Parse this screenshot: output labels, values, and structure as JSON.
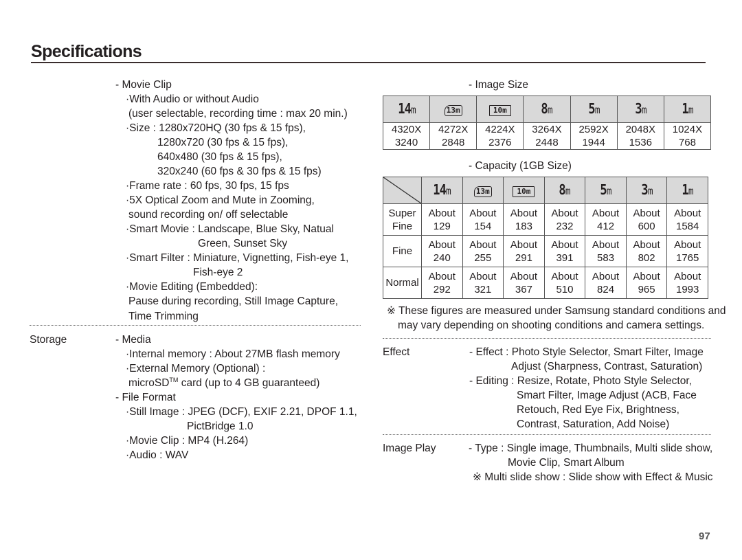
{
  "page": {
    "title": "Specifications",
    "page_number": "97"
  },
  "left_column": {
    "movie_clip": {
      "heading": "- Movie Clip",
      "lines": [
        "·With Audio or without Audio",
        "(user selectable, recording time : max 20 min.)",
        "·Size : 1280x720HQ (30 fps & 15 fps),",
        "1280x720 (30 fps & 15 fps),",
        "640x480 (30 fps & 15 fps),",
        "320x240 (60 fps & 30 fps & 15 fps)",
        "·Frame rate : 60 fps, 30 fps, 15 fps",
        "·5X Optical Zoom and Mute in Zooming,",
        "sound recording on/ off selectable",
        "·Smart Movie : Landscape, Blue Sky, Natual",
        "Green, Sunset Sky",
        "·Smart Filter : Miniature, Vignetting, Fish-eye 1,",
        "Fish-eye 2",
        "·Movie Editing (Embedded):",
        "Pause during recording, Still Image Capture,",
        "Time Trimming"
      ]
    },
    "storage": {
      "label": "Storage",
      "media_heading": "- Media",
      "internal": "·Internal memory : About 27MB flash memory",
      "external": "·External Memory (Optional) :",
      "microsd_prefix": "microSD",
      "microsd_tm": "TM",
      "microsd_suffix": " card (up to 4 GB guaranteed)",
      "file_format_heading": "- File Format",
      "still_image": "·Still Image : JPEG (DCF), EXIF 2.21, DPOF 1.1,",
      "still_image_cont": "PictBridge 1.0",
      "movie_clip": "·Movie Clip : MP4 (H.264)",
      "audio": "·Audio : WAV"
    }
  },
  "right_column": {
    "image_size": {
      "heading": "- Image Size",
      "icons": [
        {
          "name": "14m-icon",
          "main": "14",
          "unit": "m"
        },
        {
          "name": "13m-wide-icon",
          "main": "13",
          "unit": "m"
        },
        {
          "name": "10m-panorama-icon",
          "main": "10",
          "unit": "m"
        },
        {
          "name": "8m-icon",
          "main": "8",
          "unit": "m"
        },
        {
          "name": "5m-icon",
          "main": "5",
          "unit": "m"
        },
        {
          "name": "3m-icon",
          "main": "3",
          "unit": "m"
        },
        {
          "name": "1m-icon",
          "main": "1",
          "unit": "m"
        }
      ],
      "widths": [
        "4320X",
        "4272X",
        "4224X",
        "3264X",
        "2592X",
        "2048X",
        "1024X"
      ],
      "heights": [
        "3240",
        "2848",
        "2376",
        "2448",
        "1944",
        "1536",
        "768"
      ]
    },
    "capacity": {
      "heading": "- Capacity (1GB Size)",
      "rows": [
        {
          "label_line1": "Super",
          "label_line2": "Fine",
          "prefix": "About",
          "values": [
            "129",
            "154",
            "183",
            "232",
            "412",
            "600",
            "1584"
          ]
        },
        {
          "label_line1": "Fine",
          "label_line2": "",
          "prefix": "About",
          "values": [
            "240",
            "255",
            "291",
            "391",
            "583",
            "802",
            "1765"
          ]
        },
        {
          "label_line1": "Normal",
          "label_line2": "",
          "prefix": "About",
          "values": [
            "292",
            "321",
            "367",
            "510",
            "824",
            "965",
            "1993"
          ]
        }
      ],
      "note_line1": "※ These figures are measured under Samsung standard conditions and",
      "note_line2": "may vary depending on shooting conditions and camera settings."
    },
    "effect": {
      "label": "Effect",
      "lines": [
        "- Effect : Photo Style Selector, Smart Filter, Image",
        "Adjust (Sharpness, Contrast, Saturation)",
        "- Editing : Resize, Rotate, Photo Style Selector,",
        "Smart Filter, Image Adjust (ACB, Face",
        "Retouch, Red Eye Fix, Brightness,",
        "Contrast, Saturation, Add Noise)"
      ]
    },
    "image_play": {
      "label": "Image Play",
      "lines": [
        "- Type : Single image, Thumbnails, Multi slide show,",
        "Movie Clip, Smart Album",
        "※ Multi slide show : Slide show with Effect & Music"
      ]
    }
  }
}
